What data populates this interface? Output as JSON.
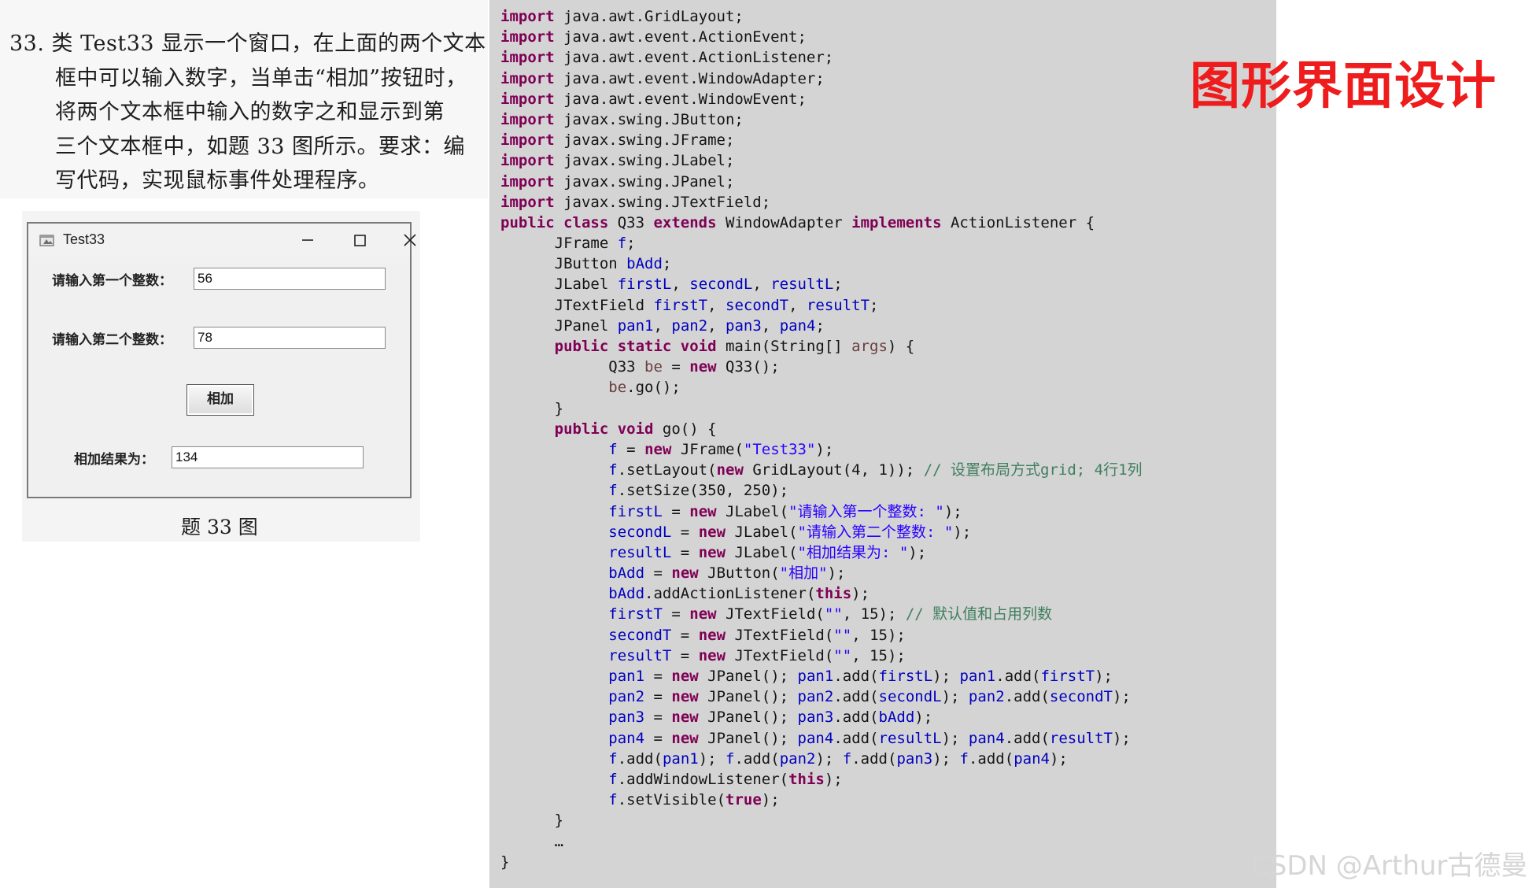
{
  "question": {
    "lines": [
      "33. 类 Test33 显示一个窗口，在上面的两个文本",
      "框中可以输入数字，当单击“相加”按钮时，",
      "将两个文本框中输入的数字之和显示到第",
      "三个文本框中，如题 33 图所示。要求：编",
      "写代码，实现鼠标事件处理程序。"
    ]
  },
  "swing_window": {
    "title": "Test33",
    "first_label": "请输入第一个整数：",
    "first_value": "56",
    "second_label": "请输入第二个整数：",
    "second_value": "78",
    "button_label": "相加",
    "result_label": "相加结果为：",
    "result_value": "134"
  },
  "figure_caption": "题 33 图",
  "section_title": "图形界面设计",
  "watermark": "CSDN @Arthur古德曼",
  "code_lines": [
    [
      [
        "kw",
        "import"
      ],
      [
        "p",
        " java.awt.GridLayout;"
      ]
    ],
    [
      [
        "kw",
        "import"
      ],
      [
        "p",
        " java.awt.event.ActionEvent;"
      ]
    ],
    [
      [
        "kw",
        "import"
      ],
      [
        "p",
        " java.awt.event.ActionListener;"
      ]
    ],
    [
      [
        "kw",
        "import"
      ],
      [
        "p",
        " java.awt.event.WindowAdapter;"
      ]
    ],
    [
      [
        "kw",
        "import"
      ],
      [
        "p",
        " java.awt.event.WindowEvent;"
      ]
    ],
    [
      [
        "kw",
        "import"
      ],
      [
        "p",
        " javax.swing.JButton;"
      ]
    ],
    [
      [
        "kw",
        "import"
      ],
      [
        "p",
        " javax.swing.JFrame;"
      ]
    ],
    [
      [
        "kw",
        "import"
      ],
      [
        "p",
        " javax.swing.JLabel;"
      ]
    ],
    [
      [
        "kw",
        "import"
      ],
      [
        "p",
        " javax.swing.JPanel;"
      ]
    ],
    [
      [
        "kw",
        "import"
      ],
      [
        "p",
        " javax.swing.JTextField;"
      ]
    ],
    [
      [
        "kw",
        "public class"
      ],
      [
        "p",
        " Q33 "
      ],
      [
        "kw",
        "extends"
      ],
      [
        "p",
        " WindowAdapter "
      ],
      [
        "kw",
        "implements"
      ],
      [
        "p",
        " ActionListener {"
      ]
    ],
    [
      [
        "p",
        "      JFrame "
      ],
      [
        "fld",
        "f"
      ],
      [
        "p",
        ";"
      ]
    ],
    [
      [
        "p",
        "      JButton "
      ],
      [
        "fld",
        "bAdd"
      ],
      [
        "p",
        ";"
      ]
    ],
    [
      [
        "p",
        "      JLabel "
      ],
      [
        "fld",
        "firstL"
      ],
      [
        "p",
        ", "
      ],
      [
        "fld",
        "secondL"
      ],
      [
        "p",
        ", "
      ],
      [
        "fld",
        "resultL"
      ],
      [
        "p",
        ";"
      ]
    ],
    [
      [
        "p",
        "      JTextField "
      ],
      [
        "fld",
        "firstT"
      ],
      [
        "p",
        ", "
      ],
      [
        "fld",
        "secondT"
      ],
      [
        "p",
        ", "
      ],
      [
        "fld",
        "resultT"
      ],
      [
        "p",
        ";"
      ]
    ],
    [
      [
        "p",
        "      JPanel "
      ],
      [
        "fld",
        "pan1"
      ],
      [
        "p",
        ", "
      ],
      [
        "fld",
        "pan2"
      ],
      [
        "p",
        ", "
      ],
      [
        "fld",
        "pan3"
      ],
      [
        "p",
        ", "
      ],
      [
        "fld",
        "pan4"
      ],
      [
        "p",
        ";"
      ]
    ],
    [
      [
        "p",
        "      "
      ],
      [
        "kw",
        "public static void"
      ],
      [
        "p",
        " main(String[] "
      ],
      [
        "var",
        "args"
      ],
      [
        "p",
        ") {"
      ]
    ],
    [
      [
        "p",
        "            Q33 "
      ],
      [
        "var",
        "be"
      ],
      [
        "p",
        " = "
      ],
      [
        "kw",
        "new"
      ],
      [
        "p",
        " Q33();"
      ]
    ],
    [
      [
        "p",
        "            "
      ],
      [
        "var",
        "be"
      ],
      [
        "p",
        ".go();"
      ]
    ],
    [
      [
        "p",
        "      }"
      ]
    ],
    [
      [
        "p",
        "      "
      ],
      [
        "kw",
        "public void"
      ],
      [
        "p",
        " go() {"
      ]
    ],
    [
      [
        "p",
        "            "
      ],
      [
        "fld",
        "f"
      ],
      [
        "p",
        " = "
      ],
      [
        "kw",
        "new"
      ],
      [
        "p",
        " JFrame("
      ],
      [
        "str",
        "\"Test33\""
      ],
      [
        "p",
        ");"
      ]
    ],
    [
      [
        "p",
        "            "
      ],
      [
        "fld",
        "f"
      ],
      [
        "p",
        ".setLayout("
      ],
      [
        "kw",
        "new"
      ],
      [
        "p",
        " GridLayout(4, 1)); "
      ],
      [
        "cmt",
        "// 设置布局方式grid; 4行1列"
      ]
    ],
    [
      [
        "p",
        "            "
      ],
      [
        "fld",
        "f"
      ],
      [
        "p",
        ".setSize(350, 250);"
      ]
    ],
    [
      [
        "p",
        "            "
      ],
      [
        "fld",
        "firstL"
      ],
      [
        "p",
        " = "
      ],
      [
        "kw",
        "new"
      ],
      [
        "p",
        " JLabel("
      ],
      [
        "str",
        "\"请输入第一个整数: \""
      ],
      [
        "p",
        ");"
      ]
    ],
    [
      [
        "p",
        "            "
      ],
      [
        "fld",
        "secondL"
      ],
      [
        "p",
        " = "
      ],
      [
        "kw",
        "new"
      ],
      [
        "p",
        " JLabel("
      ],
      [
        "str",
        "\"请输入第二个整数: \""
      ],
      [
        "p",
        ");"
      ]
    ],
    [
      [
        "p",
        "            "
      ],
      [
        "fld",
        "resultL"
      ],
      [
        "p",
        " = "
      ],
      [
        "kw",
        "new"
      ],
      [
        "p",
        " JLabel("
      ],
      [
        "str",
        "\"相加结果为: \""
      ],
      [
        "p",
        ");"
      ]
    ],
    [
      [
        "p",
        "            "
      ],
      [
        "fld",
        "bAdd"
      ],
      [
        "p",
        " = "
      ],
      [
        "kw",
        "new"
      ],
      [
        "p",
        " JButton("
      ],
      [
        "str",
        "\"相加\""
      ],
      [
        "p",
        ");"
      ]
    ],
    [
      [
        "p",
        "            "
      ],
      [
        "fld",
        "bAdd"
      ],
      [
        "p",
        ".addActionListener("
      ],
      [
        "kw",
        "this"
      ],
      [
        "p",
        ");"
      ]
    ],
    [
      [
        "p",
        "            "
      ],
      [
        "fld",
        "firstT"
      ],
      [
        "p",
        " = "
      ],
      [
        "kw",
        "new"
      ],
      [
        "p",
        " JTextField("
      ],
      [
        "str",
        "\"\""
      ],
      [
        "p",
        ", 15); "
      ],
      [
        "cmt",
        "// 默认值和占用列数"
      ]
    ],
    [
      [
        "p",
        "            "
      ],
      [
        "fld",
        "secondT"
      ],
      [
        "p",
        " = "
      ],
      [
        "kw",
        "new"
      ],
      [
        "p",
        " JTextField("
      ],
      [
        "str",
        "\"\""
      ],
      [
        "p",
        ", 15);"
      ]
    ],
    [
      [
        "p",
        "            "
      ],
      [
        "fld",
        "resultT"
      ],
      [
        "p",
        " = "
      ],
      [
        "kw",
        "new"
      ],
      [
        "p",
        " JTextField("
      ],
      [
        "str",
        "\"\""
      ],
      [
        "p",
        ", 15);"
      ]
    ],
    [
      [
        "p",
        "            "
      ],
      [
        "fld",
        "pan1"
      ],
      [
        "p",
        " = "
      ],
      [
        "kw",
        "new"
      ],
      [
        "p",
        " JPanel(); "
      ],
      [
        "fld",
        "pan1"
      ],
      [
        "p",
        ".add("
      ],
      [
        "fld",
        "firstL"
      ],
      [
        "p",
        "); "
      ],
      [
        "fld",
        "pan1"
      ],
      [
        "p",
        ".add("
      ],
      [
        "fld",
        "firstT"
      ],
      [
        "p",
        ");"
      ]
    ],
    [
      [
        "p",
        "            "
      ],
      [
        "fld",
        "pan2"
      ],
      [
        "p",
        " = "
      ],
      [
        "kw",
        "new"
      ],
      [
        "p",
        " JPanel(); "
      ],
      [
        "fld",
        "pan2"
      ],
      [
        "p",
        ".add("
      ],
      [
        "fld",
        "secondL"
      ],
      [
        "p",
        "); "
      ],
      [
        "fld",
        "pan2"
      ],
      [
        "p",
        ".add("
      ],
      [
        "fld",
        "secondT"
      ],
      [
        "p",
        ");"
      ]
    ],
    [
      [
        "p",
        "            "
      ],
      [
        "fld",
        "pan3"
      ],
      [
        "p",
        " = "
      ],
      [
        "kw",
        "new"
      ],
      [
        "p",
        " JPanel(); "
      ],
      [
        "fld",
        "pan3"
      ],
      [
        "p",
        ".add("
      ],
      [
        "fld",
        "bAdd"
      ],
      [
        "p",
        ");"
      ]
    ],
    [
      [
        "p",
        "            "
      ],
      [
        "fld",
        "pan4"
      ],
      [
        "p",
        " = "
      ],
      [
        "kw",
        "new"
      ],
      [
        "p",
        " JPanel(); "
      ],
      [
        "fld",
        "pan4"
      ],
      [
        "p",
        ".add("
      ],
      [
        "fld",
        "resultL"
      ],
      [
        "p",
        "); "
      ],
      [
        "fld",
        "pan4"
      ],
      [
        "p",
        ".add("
      ],
      [
        "fld",
        "resultT"
      ],
      [
        "p",
        ");"
      ]
    ],
    [
      [
        "p",
        "            "
      ],
      [
        "fld",
        "f"
      ],
      [
        "p",
        ".add("
      ],
      [
        "fld",
        "pan1"
      ],
      [
        "p",
        "); "
      ],
      [
        "fld",
        "f"
      ],
      [
        "p",
        ".add("
      ],
      [
        "fld",
        "pan2"
      ],
      [
        "p",
        "); "
      ],
      [
        "fld",
        "f"
      ],
      [
        "p",
        ".add("
      ],
      [
        "fld",
        "pan3"
      ],
      [
        "p",
        "); "
      ],
      [
        "fld",
        "f"
      ],
      [
        "p",
        ".add("
      ],
      [
        "fld",
        "pan4"
      ],
      [
        "p",
        ");"
      ]
    ],
    [
      [
        "p",
        "            "
      ],
      [
        "fld",
        "f"
      ],
      [
        "p",
        ".addWindowListener("
      ],
      [
        "kw",
        "this"
      ],
      [
        "p",
        ");"
      ]
    ],
    [
      [
        "p",
        "            "
      ],
      [
        "fld",
        "f"
      ],
      [
        "p",
        ".setVisible("
      ],
      [
        "kw",
        "true"
      ],
      [
        "p",
        ");"
      ]
    ],
    [
      [
        "p",
        "      }"
      ]
    ],
    [
      [
        "p",
        "      …"
      ]
    ],
    [
      [
        "p",
        "}"
      ]
    ]
  ]
}
